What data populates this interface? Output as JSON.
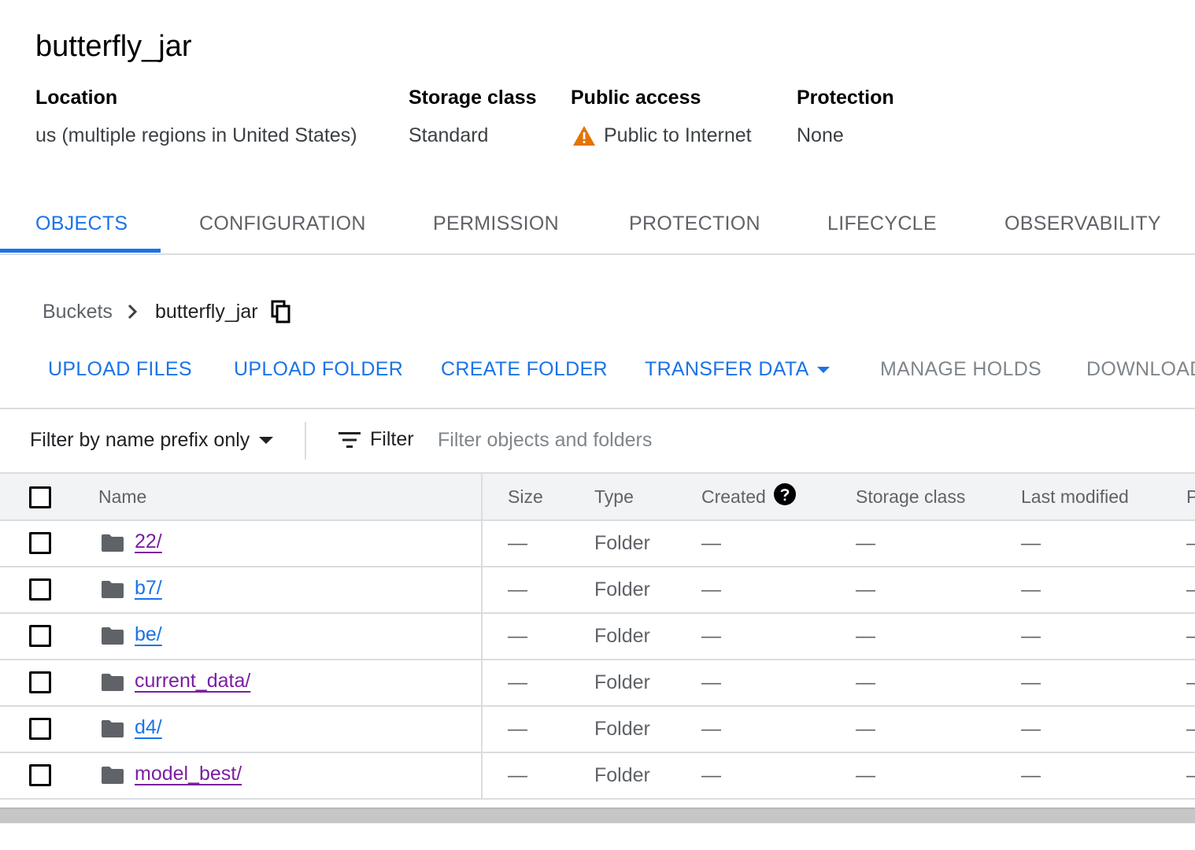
{
  "bucket": {
    "name": "butterfly_jar",
    "location_label": "Location",
    "location_value": "us (multiple regions in United States)",
    "storage_class_label": "Storage class",
    "storage_class_value": "Standard",
    "public_access_label": "Public access",
    "public_access_value": "Public to Internet",
    "protection_label": "Protection",
    "protection_value": "None"
  },
  "colors": {
    "accent": "#1a73e8",
    "warning": "#e37400",
    "visited": "#7b1fa2",
    "muted": "#5f6368"
  },
  "tabs": [
    {
      "label": "OBJECTS",
      "active": true
    },
    {
      "label": "CONFIGURATION"
    },
    {
      "label": "PERMISSION"
    },
    {
      "label": "PROTECTION"
    },
    {
      "label": "LIFECYCLE"
    },
    {
      "label": "OBSERVABILITY"
    }
  ],
  "breadcrumb": {
    "root": "Buckets",
    "current": "butterfly_jar"
  },
  "actions": {
    "upload_files": "UPLOAD FILES",
    "upload_folder": "UPLOAD FOLDER",
    "create_folder": "CREATE FOLDER",
    "transfer_data": "TRANSFER DATA",
    "manage_holds": "MANAGE HOLDS",
    "download": "DOWNLOAD"
  },
  "filter": {
    "prefix_mode": "Filter by name prefix only",
    "filter_label": "Filter",
    "placeholder": "Filter objects and folders"
  },
  "table": {
    "columns": [
      "Name",
      "Size",
      "Type",
      "Created",
      "Storage class",
      "Last modified",
      "P"
    ],
    "rows": [
      {
        "name": "22/",
        "size": "—",
        "type": "Folder",
        "created": "—",
        "storage_class": "—",
        "last_modified": "—",
        "extra": "—",
        "visited": true
      },
      {
        "name": "b7/",
        "size": "—",
        "type": "Folder",
        "created": "—",
        "storage_class": "—",
        "last_modified": "—",
        "extra": "—",
        "visited": false
      },
      {
        "name": "be/",
        "size": "—",
        "type": "Folder",
        "created": "—",
        "storage_class": "—",
        "last_modified": "—",
        "extra": "—",
        "visited": false
      },
      {
        "name": "current_data/",
        "size": "—",
        "type": "Folder",
        "created": "—",
        "storage_class": "—",
        "last_modified": "—",
        "extra": "—",
        "visited": true
      },
      {
        "name": "d4/",
        "size": "—",
        "type": "Folder",
        "created": "—",
        "storage_class": "—",
        "last_modified": "—",
        "extra": "—",
        "visited": false
      },
      {
        "name": "model_best/",
        "size": "—",
        "type": "Folder",
        "created": "—",
        "storage_class": "—",
        "last_modified": "—",
        "extra": "—",
        "visited": true
      }
    ]
  }
}
